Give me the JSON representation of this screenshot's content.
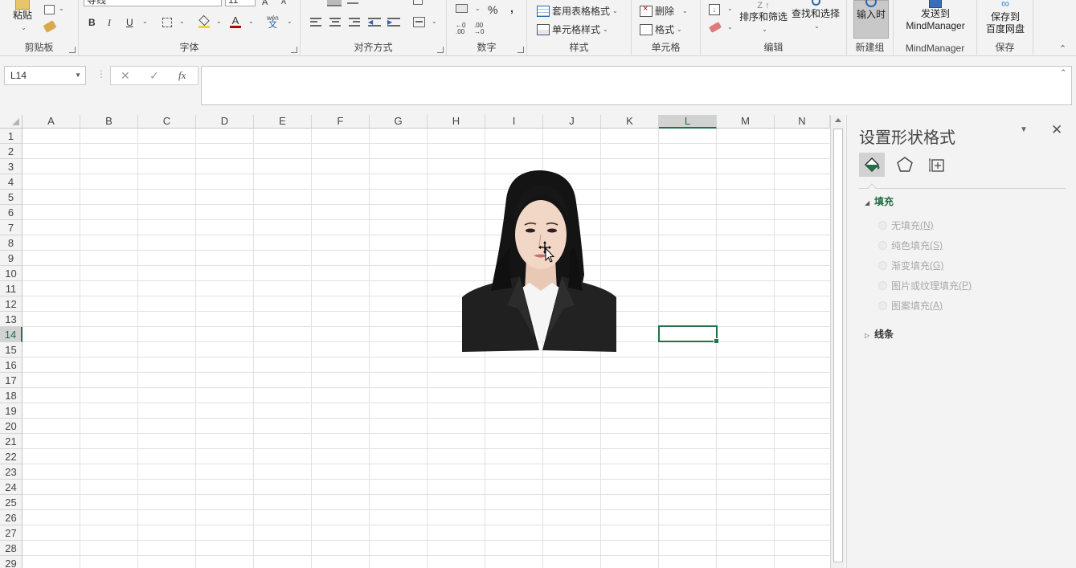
{
  "ribbon": {
    "clipboard": {
      "paste_label": "粘贴",
      "group_label": "剪贴板"
    },
    "font": {
      "font_name": "等线",
      "font_size": "11",
      "bold": "B",
      "italic": "I",
      "underline": "U",
      "phonetic_label": "wén",
      "phonetic_char": "文",
      "group_label": "字体"
    },
    "alignment": {
      "group_label": "对齐方式"
    },
    "number": {
      "percent": "%",
      "comma": ",",
      "group_label": "数字"
    },
    "styles": {
      "table_format": "套用表格格式",
      "cell_styles": "单元格样式",
      "group_label": "样式"
    },
    "cells": {
      "delete": "删除",
      "format": "格式",
      "group_label": "单元格"
    },
    "editing": {
      "sort_filter": "排序和筛选",
      "find_select": "查找和选择",
      "group_label": "编辑"
    },
    "new_group": {
      "input_time": "输入时",
      "group_label": "新建组"
    },
    "mindmanager": {
      "send_to": "发送到",
      "send_to_2": "MindManager",
      "group_label": "MindManager"
    },
    "save": {
      "save_to": "保存到",
      "save_to_2": "百度网盘",
      "group_label": "保存"
    }
  },
  "formula_bar": {
    "name_box": "L14",
    "fx": "fx",
    "formula": ""
  },
  "grid": {
    "columns": [
      "A",
      "B",
      "C",
      "D",
      "E",
      "F",
      "G",
      "H",
      "I",
      "J",
      "K",
      "L",
      "M",
      "N"
    ],
    "rows": [
      "1",
      "2",
      "3",
      "4",
      "5",
      "6",
      "7",
      "8",
      "9",
      "10",
      "11",
      "12",
      "13",
      "14",
      "15",
      "16",
      "17",
      "18",
      "19",
      "20",
      "21",
      "22",
      "23",
      "24",
      "25",
      "26",
      "27",
      "28",
      "29"
    ],
    "selected_column": "L",
    "selected_row": "14"
  },
  "pane": {
    "title": "设置形状格式",
    "fill_section": "填充",
    "fill_options": [
      {
        "label": "无填充",
        "key": "(N)"
      },
      {
        "label": "纯色填充",
        "key": "(S)"
      },
      {
        "label": "渐变填充",
        "key": "(G)"
      },
      {
        "label": "图片或纹理填充",
        "key": "(P)"
      },
      {
        "label": "图案填充",
        "key": "(A)"
      }
    ],
    "line_section": "线条"
  },
  "colors": {
    "excel_green": "#217346",
    "pane_heading": "#1e6e42"
  }
}
